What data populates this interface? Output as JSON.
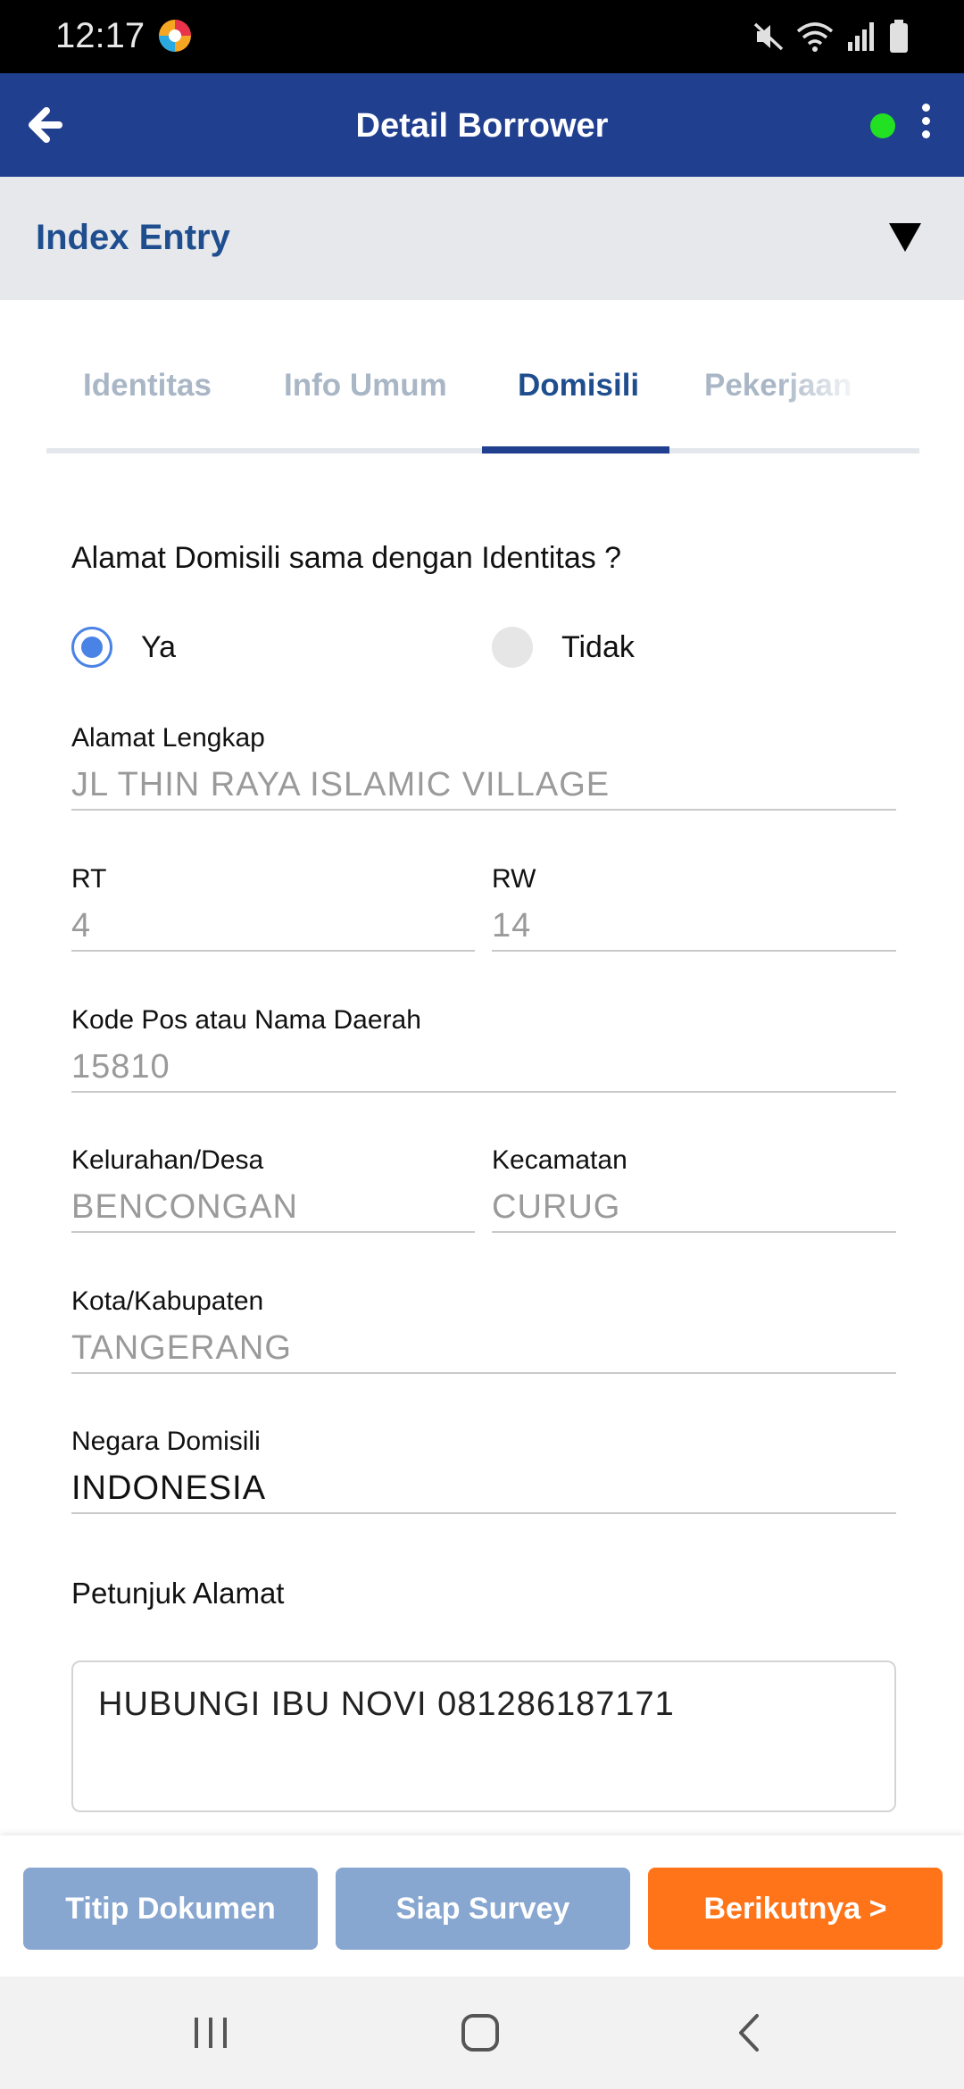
{
  "status_bar": {
    "time": "12:17",
    "icons": [
      "app-notification-icon",
      "mute-icon",
      "wifi-icon",
      "signal-icon",
      "battery-icon"
    ]
  },
  "app_bar": {
    "title": "Detail Borrower",
    "back_icon": "arrow-left-icon",
    "status_dot_color": "#22e022",
    "menu_icon": "more-vertical-icon"
  },
  "section": {
    "title": "Index Entry",
    "toggle_icon": "triangle-down-icon"
  },
  "tabs": [
    {
      "label": "Identitas",
      "active": false
    },
    {
      "label": "Info Umum",
      "active": false
    },
    {
      "label": "Domisili",
      "active": true
    },
    {
      "label": "Pekerjaan",
      "active": false
    }
  ],
  "form": {
    "question": "Alamat Domisili sama dengan Identitas ?",
    "options": [
      {
        "label": "Ya",
        "selected": true
      },
      {
        "label": "Tidak",
        "selected": false
      }
    ],
    "fields": {
      "alamat_lengkap": {
        "label": "Alamat Lengkap",
        "value": "JL THIN RAYA ISLAMIC VILLAGE"
      },
      "rt": {
        "label": "RT",
        "value": "4"
      },
      "rw": {
        "label": "RW",
        "value": "14"
      },
      "kode_pos": {
        "label": "Kode Pos atau Nama Daerah",
        "value": "15810"
      },
      "kelurahan": {
        "label": "Kelurahan/Desa",
        "value": "BENCONGAN"
      },
      "kecamatan": {
        "label": "Kecamatan",
        "value": "CURUG"
      },
      "kota": {
        "label": "Kota/Kabupaten",
        "value": "TANGERANG"
      },
      "negara": {
        "label": "Negara Domisili",
        "value": "INDONESIA"
      }
    },
    "petunjuk": {
      "label": "Petunjuk Alamat",
      "value": "HUBUNGI IBU NOVI 081286187171"
    }
  },
  "actions": {
    "titip": "Titip Dokumen",
    "siap": "Siap Survey",
    "next": "Berikutnya >"
  },
  "colors": {
    "primary": "#213f8f",
    "accent_orange": "#ff7418",
    "disabled_button": "#87a6d0",
    "radio_selected": "#4a83e6"
  },
  "nav_bar": [
    "recent-apps-icon",
    "home-icon",
    "back-icon"
  ]
}
